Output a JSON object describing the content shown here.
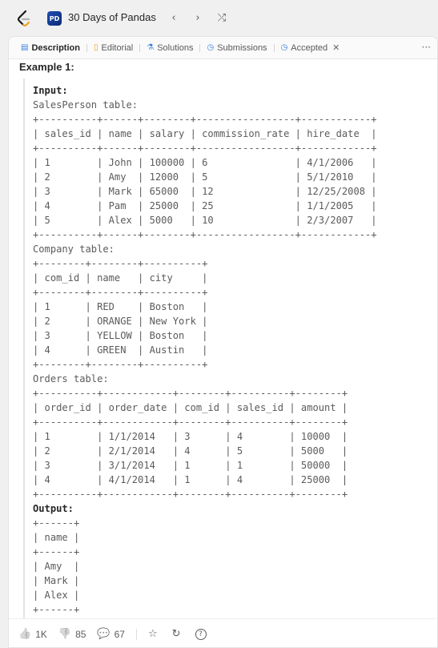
{
  "header": {
    "badge": "PD",
    "title": "30 Days of Pandas",
    "prev_glyph": "‹",
    "next_glyph": "›",
    "shuffle_glyph": "⤮"
  },
  "tabs": [
    {
      "label": "Description",
      "icon": "description-icon",
      "glyph": "▤"
    },
    {
      "label": "Editorial",
      "icon": "editorial-icon",
      "glyph": "▯"
    },
    {
      "label": "Solutions",
      "icon": "solutions-icon",
      "glyph": "⚗"
    },
    {
      "label": "Submissions",
      "icon": "submissions-icon",
      "glyph": "◷"
    },
    {
      "label": "Accepted",
      "icon": "accepted-icon",
      "glyph": "◷"
    }
  ],
  "more_glyph": "···",
  "close_glyph": "✕",
  "example": {
    "title": "Example 1:",
    "input_label": "Input:",
    "output_label": "Output:",
    "input_text": "SalesPerson table:\n+----------+------+--------+-----------------+------------+\n| sales_id | name | salary | commission_rate | hire_date  |\n+----------+------+--------+-----------------+------------+\n| 1        | John | 100000 | 6               | 4/1/2006   |\n| 2        | Amy  | 12000  | 5               | 5/1/2010   |\n| 3        | Mark | 65000  | 12              | 12/25/2008 |\n| 4        | Pam  | 25000  | 25              | 1/1/2005   |\n| 5        | Alex | 5000   | 10              | 2/3/2007   |\n+----------+------+--------+-----------------+------------+\nCompany table:\n+--------+--------+----------+\n| com_id | name   | city     |\n+--------+--------+----------+\n| 1      | RED    | Boston   |\n| 2      | ORANGE | New York |\n| 3      | YELLOW | Boston   |\n| 4      | GREEN  | Austin   |\n+--------+--------+----------+\nOrders table:\n+----------+------------+--------+----------+--------+\n| order_id | order_date | com_id | sales_id | amount |\n+----------+------------+--------+----------+--------+\n| 1        | 1/1/2014   | 3      | 4        | 10000  |\n| 2        | 2/1/2014   | 4      | 5        | 5000   |\n| 3        | 3/1/2014   | 1      | 1        | 50000  |\n| 4        | 4/1/2014   | 1      | 4        | 25000  |\n+----------+------------+--------+----------+--------+",
    "output_text": "+------+\n| name |\n+------+\n| Amy  |\n| Mark |\n| Alex |\n+------+"
  },
  "footer": {
    "likes": "1K",
    "dislikes": "85",
    "comments": "67",
    "like_glyph": "👍",
    "dislike_glyph": "👎",
    "comment_glyph": "💬",
    "star_glyph": "☆",
    "share_glyph": "↻",
    "help_glyph": "?"
  }
}
